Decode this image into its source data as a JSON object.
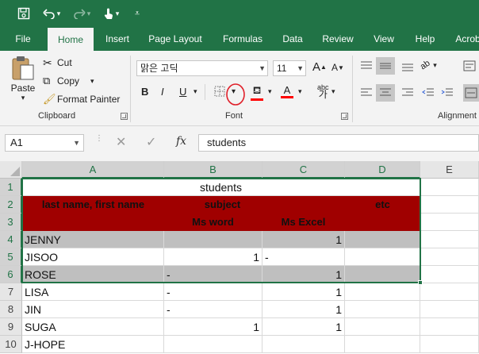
{
  "quick_access": {
    "save_icon": "save-icon",
    "undo_icon": "undo-icon",
    "redo_icon": "redo-icon",
    "touch_icon": "touch-mode-icon",
    "customize_icon": "customize-qat-icon"
  },
  "tabs": [
    "File",
    "Home",
    "Insert",
    "Page Layout",
    "Formulas",
    "Data",
    "Review",
    "View",
    "Help",
    "Acrob"
  ],
  "active_tab": "Home",
  "ribbon": {
    "clipboard": {
      "paste_label": "Paste",
      "cut_label": "Cut",
      "copy_label": "Copy",
      "format_painter_label": "Format Painter",
      "group_label": "Clipboard"
    },
    "font": {
      "font_name": "맑은 고딕",
      "font_size": "11",
      "bold": "B",
      "italic": "I",
      "underline": "U",
      "group_label": "Font"
    },
    "alignment": {
      "group_label": "Alignment"
    }
  },
  "formula_bar": {
    "name_box": "A1",
    "fx_label": "fx",
    "value": "students"
  },
  "grid": {
    "columns": [
      "A",
      "B",
      "C",
      "D",
      "E"
    ],
    "rows": [
      "1",
      "2",
      "3",
      "4",
      "5",
      "6",
      "7",
      "8",
      "9",
      "10"
    ],
    "title": "students",
    "header": {
      "name": "last name, first name",
      "subject": "subject",
      "etc": "etc",
      "ms_word": "Ms word",
      "ms_excel": "Ms Excel"
    },
    "data_rows": [
      {
        "name": "JENNY",
        "b": "",
        "c": "1"
      },
      {
        "name": "JISOO",
        "b": "1",
        "c": "-"
      },
      {
        "name": "ROSE",
        "b": "-",
        "c": "1"
      },
      {
        "name": "LISA",
        "b": "-",
        "c": "1"
      },
      {
        "name": "JIN",
        "b": "-",
        "c": "1"
      },
      {
        "name": "SUGA",
        "b": "1",
        "c": "1"
      },
      {
        "name": "J-HOPE",
        "b": "",
        "c": ""
      }
    ]
  },
  "colors": {
    "excel_green": "#217346",
    "header_fill": "#a00000",
    "gray_fill": "#bfbfbf",
    "annotation_circle": "#e0202a"
  }
}
